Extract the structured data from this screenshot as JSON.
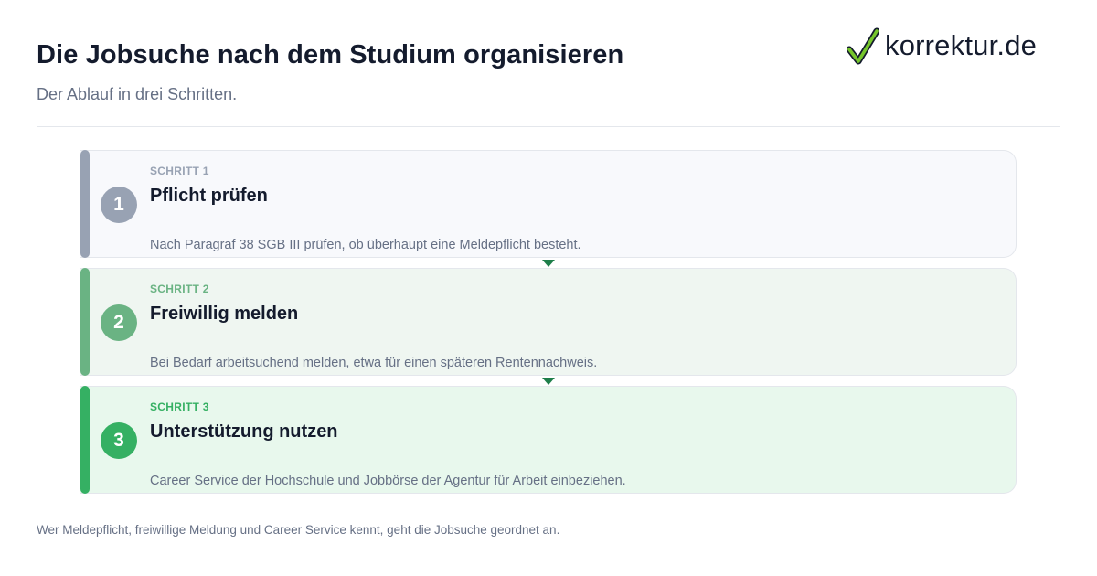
{
  "header": {
    "title": "Die Jobsuche nach dem Studium organisieren",
    "subtitle": "Der Ablauf in drei Schritten."
  },
  "logo": {
    "icon": "check-mark-icon",
    "text": "korrektur.de",
    "check_color": "#76c62c",
    "check_outline": "#141b2d"
  },
  "steps": [
    {
      "number": "1",
      "label": "SCHRITT 1",
      "title": "Pflicht prüfen",
      "description": "Nach Paragraf 38 SGB III prüfen, ob überhaupt eine Meldepflicht besteht.",
      "accent_color": "#98a2b3",
      "background_color": "#f8f9fc"
    },
    {
      "number": "2",
      "label": "SCHRITT 2",
      "title": "Freiwillig melden",
      "description": "Bei Bedarf arbeitsuchend melden, etwa für einen späteren Rentennachweis.",
      "accent_color": "#6ab383",
      "background_color": "#eff6f1"
    },
    {
      "number": "3",
      "label": "SCHRITT 3",
      "title": "Unterstützung nutzen",
      "description": "Career Service der Hochschule und Jobbörse der Agentur für Arbeit einbeziehen.",
      "accent_color": "#35b063",
      "background_color": "#e8f8ed"
    }
  ],
  "connector_color": "#1e7e4a",
  "footer": {
    "note": "Wer Meldepflicht, freiwillige Meldung und Career Service kennt, geht die Jobsuche geordnet an."
  }
}
